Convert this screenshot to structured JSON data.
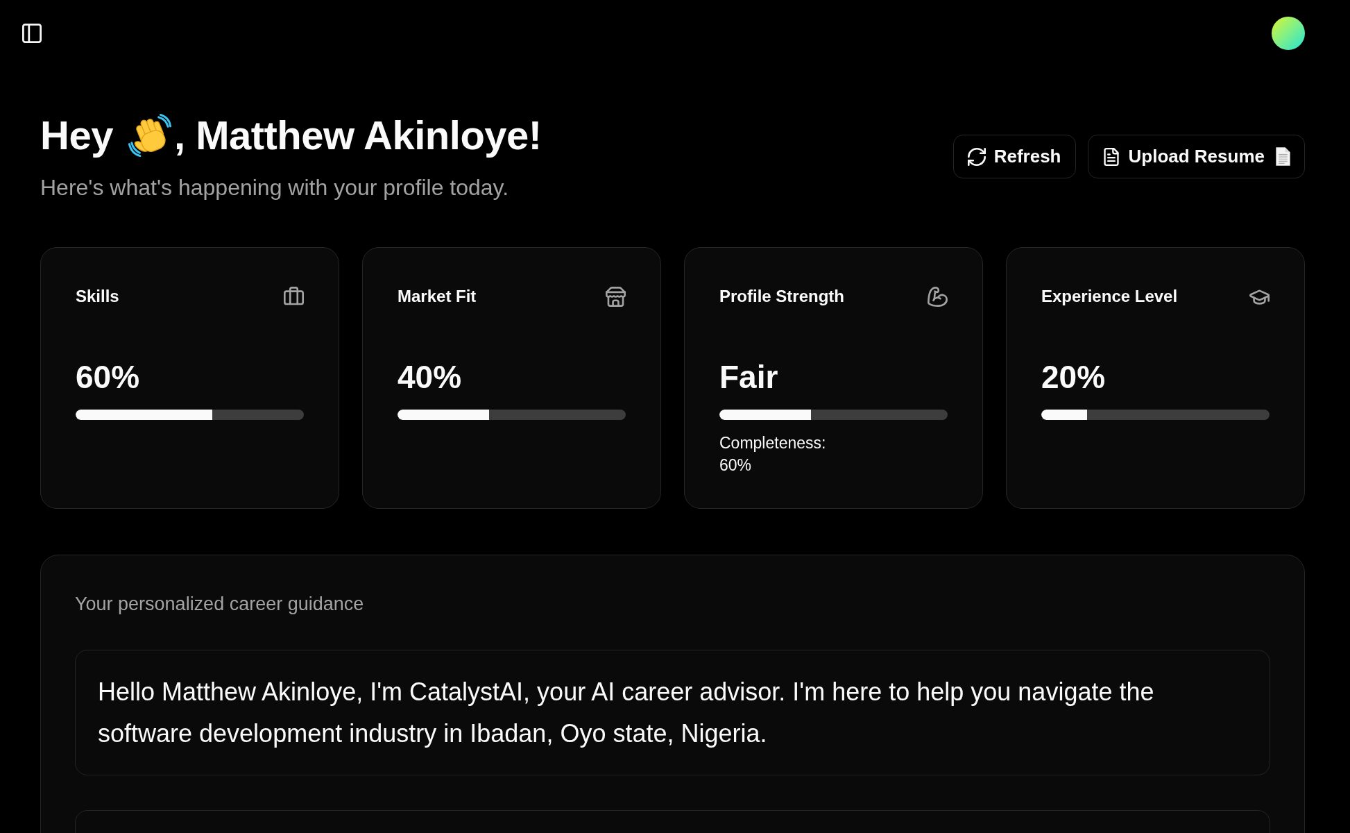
{
  "greeting": {
    "before_emoji": "Hey",
    "after_emoji": ", Matthew Akinloye!",
    "subtitle": "Here's what's happening with your profile today."
  },
  "actions": [
    {
      "kind": "refresh",
      "label": "Refresh"
    },
    {
      "kind": "upload",
      "label": "Upload Resume"
    }
  ],
  "stats": [
    {
      "title": "Skills",
      "value": "60%",
      "level": 0.6
    },
    {
      "title": "Market Fit",
      "value": "40%",
      "level": 0.4
    },
    {
      "title": "Profile Strength",
      "value": "Fair",
      "level": 0.4,
      "note": "Completeness: 60%"
    },
    {
      "title": "Experience Level",
      "value": "20%",
      "level": 0.2
    }
  ],
  "guidance": {
    "label": "Your personalized career guidance",
    "messages": [
      {
        "text": "Hello Matthew Akinloye, I'm CatalystAI, your AI career advisor. I'm here to help you navigate the software development industry in Ibadan, Oyo state, Nigeria."
      }
    ]
  }
}
